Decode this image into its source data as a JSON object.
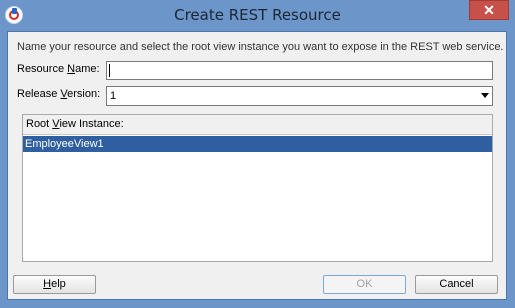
{
  "window": {
    "title": "Create REST Resource",
    "close_glyph": "✕",
    "app_icon": "oracle-jdeveloper-icon"
  },
  "dialog": {
    "description": "Name your resource and select the root view instance you want to expose in the REST web service.",
    "resource_name": {
      "label_prefix": "Resource ",
      "label_mnemonic": "N",
      "label_suffix": "ame:",
      "value": ""
    },
    "release_version": {
      "label_prefix": "Release ",
      "label_mnemonic": "V",
      "label_suffix": "ersion:",
      "selected": "1"
    },
    "root_view_instance": {
      "label_prefix": "Root ",
      "label_mnemonic": "V",
      "label_suffix": "iew Instance:",
      "items": [
        "EmployeeView1"
      ]
    },
    "buttons": {
      "help_mnemonic": "H",
      "help_rest": "elp",
      "ok": "OK",
      "cancel": "Cancel"
    }
  }
}
